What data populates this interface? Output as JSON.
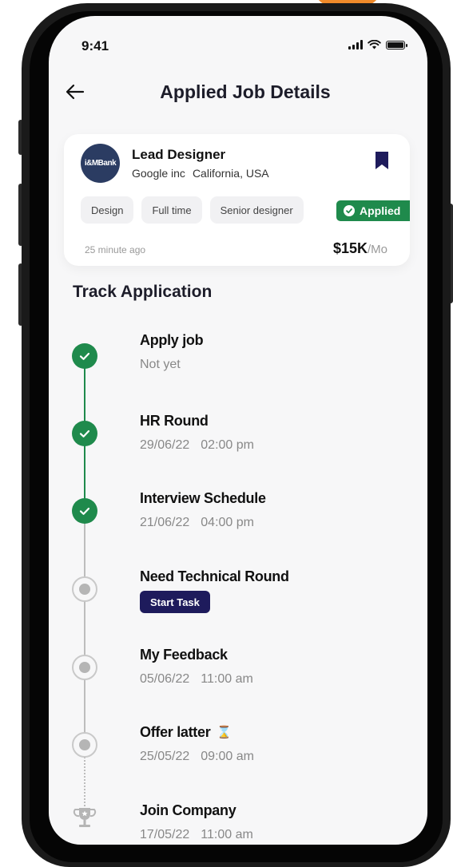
{
  "status_bar": {
    "time": "9:41"
  },
  "header": {
    "title": "Applied Job Details"
  },
  "job": {
    "logo_text": "i&MBank",
    "title": "Lead Designer",
    "company": "Google inc",
    "location": "California, USA",
    "tags": [
      "Design",
      "Full time",
      "Senior designer"
    ],
    "status_badge": "Applied",
    "posted": "25 minute ago",
    "salary_amount": "$15K",
    "salary_period": "/Mo"
  },
  "track": {
    "title": "Track Application",
    "steps": [
      {
        "title": "Apply job",
        "date": "Not yet",
        "time": "",
        "state": "done"
      },
      {
        "title": "HR Round",
        "date": "29/06/22",
        "time": "02:00 pm",
        "state": "done"
      },
      {
        "title": "Interview Schedule",
        "date": "21/06/22",
        "time": "04:00 pm",
        "state": "done"
      },
      {
        "title": "Need Technical Round",
        "action": "Start Task",
        "state": "pending"
      },
      {
        "title": "My Feedback",
        "date": "05/06/22",
        "time": "11:00 am",
        "state": "pending"
      },
      {
        "title": "Offer latter",
        "date": "25/05/22",
        "time": "09:00 am",
        "state": "pending",
        "icon": "hourglass-icon"
      },
      {
        "title": "Join Company",
        "date": "17/05/22",
        "time": "11:00 am",
        "state": "final",
        "icon": "trophy-icon"
      }
    ]
  },
  "colors": {
    "accent_green": "#1f8a4c",
    "navy": "#1e1b5c",
    "bookmark": "#1e1b5c"
  }
}
